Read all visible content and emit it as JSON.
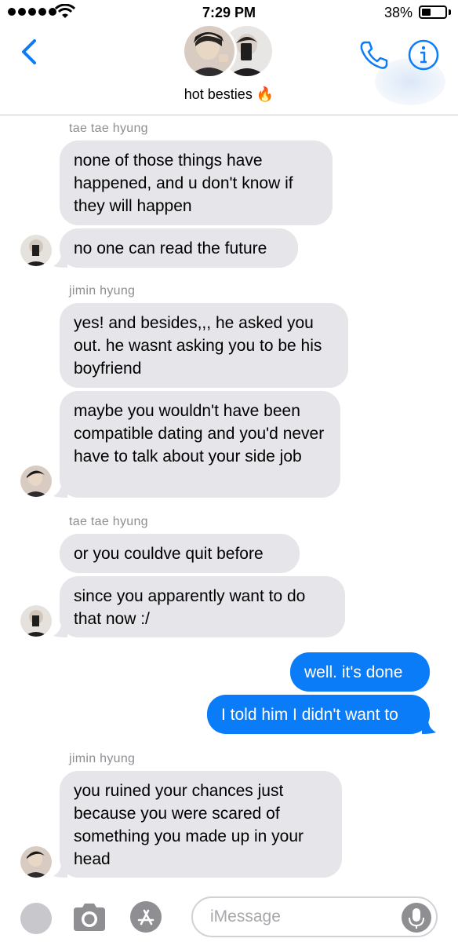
{
  "status_bar": {
    "time": "7:29 PM",
    "battery": "38%",
    "battery_level": 0.38
  },
  "header": {
    "group_name": "hot besties 🔥"
  },
  "messages": [
    {
      "sender": "tae tae hyung",
      "text": "none of those things have happened, and u don't know if they will happen"
    },
    {
      "text": "no one can read the future"
    },
    {
      "sender": "jimin hyung",
      "text": "yes! and besides,,, he asked you out. he wasnt asking you to be his boyfriend"
    },
    {
      "text": "maybe you wouldn't have been compatible dating and you'd never have to talk about your side job"
    },
    {
      "sender": "tae tae hyung",
      "text": "or you couldve quit before"
    },
    {
      "text": "since you apparently want to do that now :/"
    },
    {
      "text": "well. it's done"
    },
    {
      "text": "I told him I didn't want to"
    },
    {
      "sender": "jimin hyung",
      "text": "you ruined your chances just because you were scared of something you made up in your head"
    }
  ],
  "input_bar": {
    "placeholder": "iMessage"
  },
  "colors": {
    "accent": "#0b7cf8",
    "incoming": "#e5e5ea",
    "sender_label": "#8e8e93"
  },
  "icons": [
    "back-chevron-icon",
    "phone-icon",
    "info-icon",
    "camera-icon",
    "app-store-icon",
    "microphone-icon"
  ]
}
